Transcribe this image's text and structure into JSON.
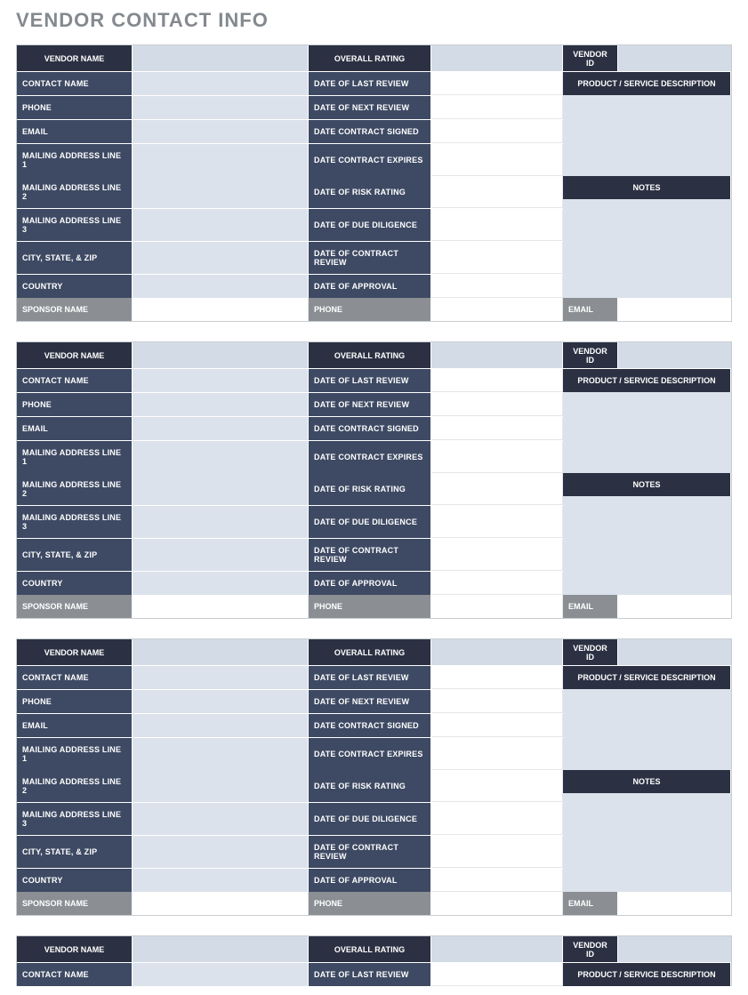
{
  "title": "VENDOR CONTACT INFO",
  "labels": {
    "vendor_name": "VENDOR NAME",
    "overall_rating": "OVERALL RATING",
    "vendor_id": "VENDOR ID",
    "contact_name": "CONTACT NAME",
    "date_last_review": "DATE OF LAST REVIEW",
    "product_desc": "PRODUCT / SERVICE DESCRIPTION",
    "phone": "PHONE",
    "date_next_review": "DATE OF NEXT REVIEW",
    "email": "EMAIL",
    "date_contract_signed": "DATE CONTRACT SIGNED",
    "mailing1": "MAILING ADDRESS LINE 1",
    "date_contract_expires": "DATE CONTRACT EXPIRES",
    "mailing2": "MAILING ADDRESS LINE 2",
    "date_risk_rating": "DATE OF RISK RATING",
    "notes": "NOTES",
    "mailing3": "MAILING ADDRESS LINE 3",
    "date_due_diligence": "DATE OF DUE DILIGENCE",
    "city_state_zip": "CITY, STATE, & ZIP",
    "date_contract_review": "DATE OF CONTRACT REVIEW",
    "country": "COUNTRY",
    "date_approval": "DATE OF APPROVAL",
    "sponsor_name": "SPONSOR NAME",
    "sponsor_phone": "PHONE",
    "sponsor_email": "EMAIL"
  },
  "vendors": [
    {
      "vendor_name": "",
      "overall_rating": "",
      "vendor_id": "",
      "contact_name": "",
      "date_last_review": "",
      "product_desc": "",
      "phone": "",
      "date_next_review": "",
      "email": "",
      "date_contract_signed": "",
      "mailing1": "",
      "date_contract_expires": "",
      "mailing2": "",
      "date_risk_rating": "",
      "notes": "",
      "mailing3": "",
      "date_due_diligence": "",
      "city_state_zip": "",
      "date_contract_review": "",
      "country": "",
      "date_approval": "",
      "sponsor_name": "",
      "sponsor_phone": "",
      "sponsor_email": ""
    },
    {
      "vendor_name": "",
      "overall_rating": "",
      "vendor_id": "",
      "contact_name": "",
      "date_last_review": "",
      "product_desc": "",
      "phone": "",
      "date_next_review": "",
      "email": "",
      "date_contract_signed": "",
      "mailing1": "",
      "date_contract_expires": "",
      "mailing2": "",
      "date_risk_rating": "",
      "notes": "",
      "mailing3": "",
      "date_due_diligence": "",
      "city_state_zip": "",
      "date_contract_review": "",
      "country": "",
      "date_approval": "",
      "sponsor_name": "",
      "sponsor_phone": "",
      "sponsor_email": ""
    },
    {
      "vendor_name": "",
      "overall_rating": "",
      "vendor_id": "",
      "contact_name": "",
      "date_last_review": "",
      "product_desc": "",
      "phone": "",
      "date_next_review": "",
      "email": "",
      "date_contract_signed": "",
      "mailing1": "",
      "date_contract_expires": "",
      "mailing2": "",
      "date_risk_rating": "",
      "notes": "",
      "mailing3": "",
      "date_due_diligence": "",
      "city_state_zip": "",
      "date_contract_review": "",
      "country": "",
      "date_approval": "",
      "sponsor_name": "",
      "sponsor_phone": "",
      "sponsor_email": ""
    },
    {
      "vendor_name": "",
      "overall_rating": "",
      "vendor_id": "",
      "contact_name": "",
      "date_last_review": "",
      "product_desc": "",
      "phone": "",
      "date_next_review": "",
      "email": "",
      "date_contract_signed": "",
      "mailing1": "",
      "date_contract_expires": "",
      "mailing2": "",
      "date_risk_rating": "",
      "notes": "",
      "mailing3": "",
      "date_due_diligence": "",
      "city_state_zip": "",
      "date_contract_review": "",
      "country": "",
      "date_approval": "",
      "sponsor_name": "",
      "sponsor_phone": "",
      "sponsor_email": ""
    }
  ]
}
